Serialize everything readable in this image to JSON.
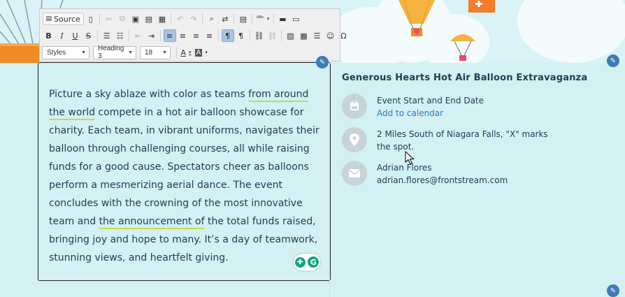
{
  "toolbar": {
    "source_label": "Source",
    "styles_label": "Styles",
    "format_label": "Heading 3",
    "size_label": "18",
    "bold": "B",
    "italic": "I",
    "underline": "U",
    "strike": "S",
    "special_char": "Ω"
  },
  "editor": {
    "t1": "Picture a sky ablaze with color as teams ",
    "t2": "from around the world",
    "t3": " compete in a hot air balloon showcase for charity. Each team, in vibrant uniforms, navigates their balloon through challenging courses, all while raising funds for a good cause. Spectators cheer as balloons perform a mesmerizing aerial dance. The event concludes with the crowning of the most innovative team and ",
    "t4": "the announcement of",
    "t5": " the total funds raised, bringing joy and hope to many. It’s a day of teamwork, stunning views, and heartfelt giving."
  },
  "event": {
    "title": "Generous Hearts Hot Air Balloon Extravaganza",
    "date_label": "Event Start and End Date",
    "calendar_link": "Add to calendar",
    "location": "2 Miles South of Niagara Falls, \"X\" marks the spot.",
    "contact_name": "Adrian Flores",
    "contact_email": "adrian.flores@frontstream.com"
  },
  "colors": {
    "background": "#d3f0f2",
    "text": "#1c3d55",
    "link": "#2f7fb5",
    "edit_button": "#3e7ab6"
  }
}
